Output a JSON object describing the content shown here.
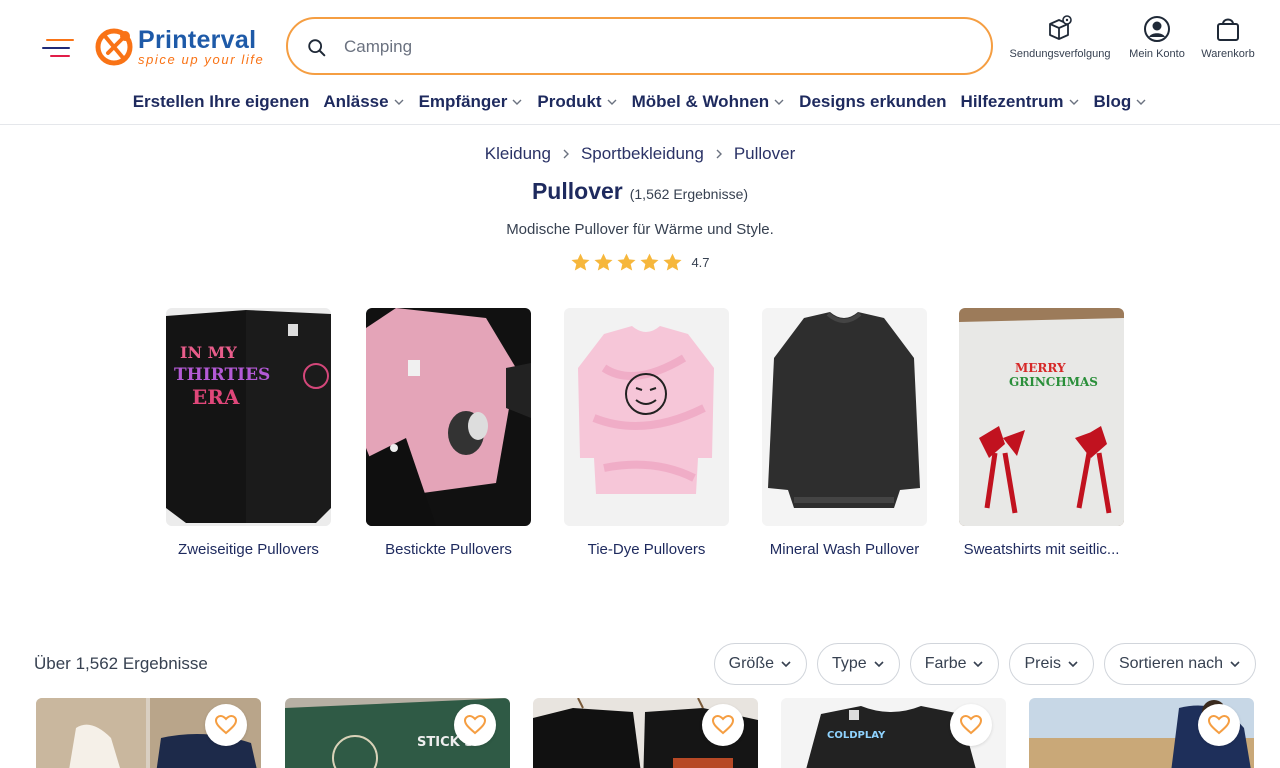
{
  "header": {
    "logo_name": "Printerval",
    "logo_tagline": "spice up your life",
    "search_placeholder": "Camping",
    "actions": {
      "tracking": "Sendungsverfolgung",
      "account": "Mein Konto",
      "cart": "Warenkorb"
    }
  },
  "nav": [
    {
      "label": "Erstellen Ihre eigenen",
      "dropdown": false
    },
    {
      "label": "Anlässe",
      "dropdown": true
    },
    {
      "label": "Empfänger",
      "dropdown": true
    },
    {
      "label": "Produkt",
      "dropdown": true
    },
    {
      "label": "Möbel & Wohnen",
      "dropdown": true
    },
    {
      "label": "Designs erkunden",
      "dropdown": false
    },
    {
      "label": "Hilfezentrum",
      "dropdown": true
    },
    {
      "label": "Blog",
      "dropdown": true
    }
  ],
  "breadcrumb": [
    "Kleidung",
    "Sportbekleidung",
    "Pullover"
  ],
  "page": {
    "title": "Pullover",
    "result_count": "(1,562 Ergebnisse)",
    "description": "Modische Pullover für Wärme und Style.",
    "rating": "4.7",
    "stars": 5
  },
  "categories": [
    {
      "label": "Zweiseitige Pullovers"
    },
    {
      "label": "Bestickte Pullovers"
    },
    {
      "label": "Tie-Dye Pullovers"
    },
    {
      "label": "Mineral Wash Pullover"
    },
    {
      "label": "Sweatshirts mit seitlic..."
    }
  ],
  "results": {
    "label": "Über 1,562 Ergebnisse",
    "filters": [
      "Größe",
      "Type",
      "Farbe",
      "Preis",
      "Sortieren nach"
    ]
  },
  "colors": {
    "brand_orange": "#f97316",
    "brand_blue": "#1e5aa8",
    "nav_text": "#1e2a5e",
    "star": "#f6b73c",
    "favorite_heart": "#f59e42"
  }
}
